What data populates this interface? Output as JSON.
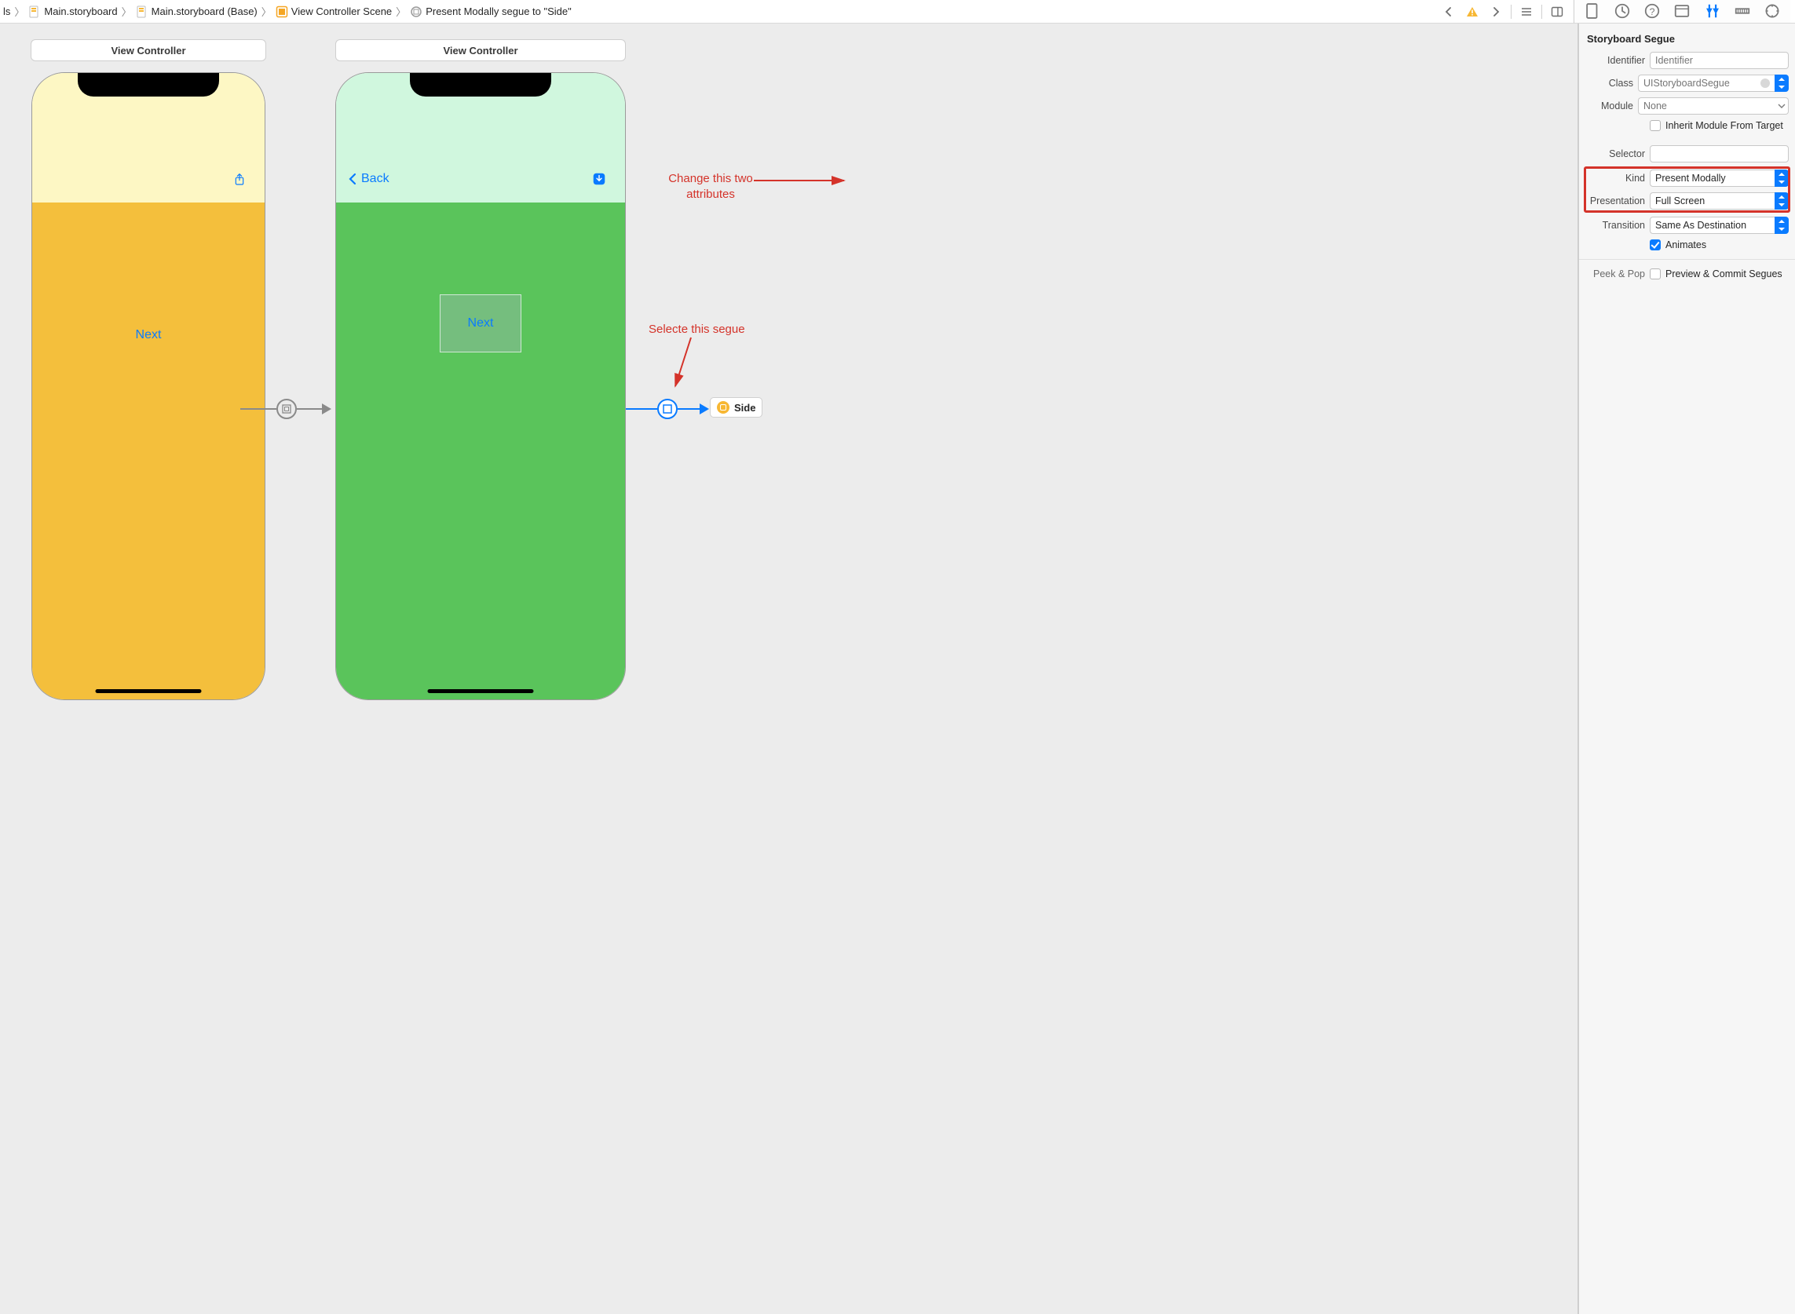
{
  "breadcrumb": {
    "items": [
      {
        "label": "ls"
      },
      {
        "label": "Main.storyboard"
      },
      {
        "label": "Main.storyboard (Base)"
      },
      {
        "label": "View Controller Scene"
      },
      {
        "label": "Present Modally segue to \"Side\""
      }
    ]
  },
  "canvas": {
    "vc1": {
      "title": "View Controller",
      "next_label": "Next"
    },
    "vc2": {
      "title": "View Controller",
      "back_label": "Back",
      "next_label": "Next"
    },
    "side_badge": "Side"
  },
  "annotations": {
    "change_attrs": "Change this two\nattributes",
    "select_segue": "Selecte this segue"
  },
  "inspector": {
    "section": "Storyboard Segue",
    "identifier": {
      "label": "Identifier",
      "placeholder": "Identifier",
      "value": ""
    },
    "class": {
      "label": "Class",
      "placeholder": "UIStoryboardSegue",
      "value": ""
    },
    "module": {
      "label": "Module",
      "placeholder": "None",
      "value": ""
    },
    "inherit": {
      "label": "Inherit Module From Target",
      "checked": false
    },
    "selector": {
      "label": "Selector",
      "value": ""
    },
    "kind": {
      "label": "Kind",
      "value": "Present Modally"
    },
    "presentation": {
      "label": "Presentation",
      "value": "Full Screen"
    },
    "transition": {
      "label": "Transition",
      "value": "Same As Destination"
    },
    "animates": {
      "label": "Animates",
      "checked": true
    },
    "peekpop": {
      "label": "Peek & Pop",
      "option": "Preview & Commit Segues",
      "checked": false
    }
  }
}
